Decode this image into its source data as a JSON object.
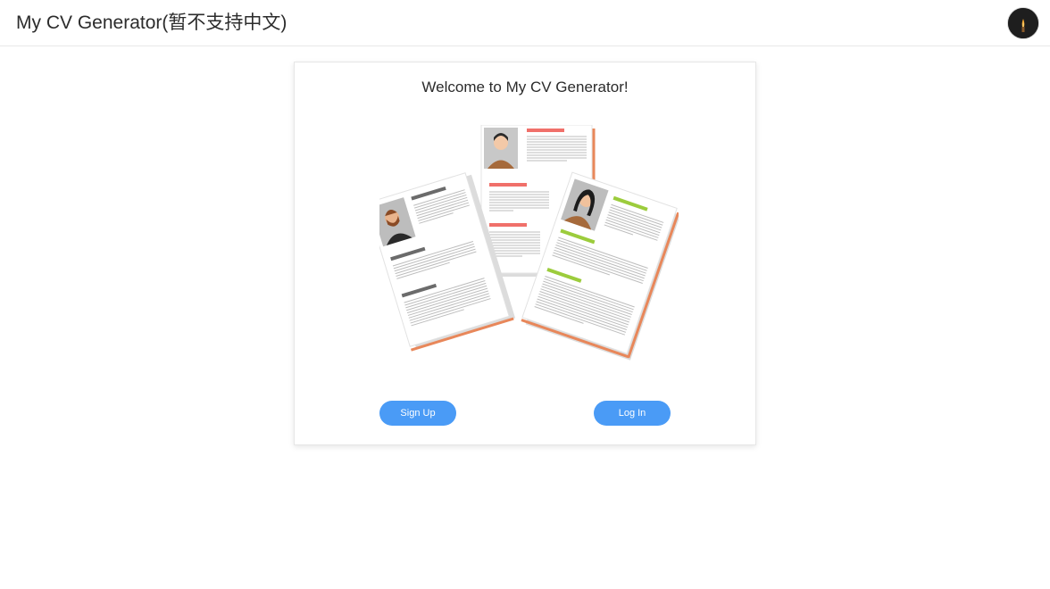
{
  "header": {
    "title": "My CV Generator(暂不支持中文)",
    "avatar_icon": "user-avatar-icon"
  },
  "card": {
    "welcome_text": "Welcome to My CV Generator!",
    "illustration_icon": "resume-documents-illustration",
    "signup_label": "Sign Up",
    "login_label": "Log In"
  },
  "colors": {
    "accent_blue": "#4a9bf6",
    "orange_edge": "#e8875a",
    "red_bar": "#f0706a",
    "green_bar": "#9ccc3c",
    "grey_bar": "#6b6b6b"
  }
}
